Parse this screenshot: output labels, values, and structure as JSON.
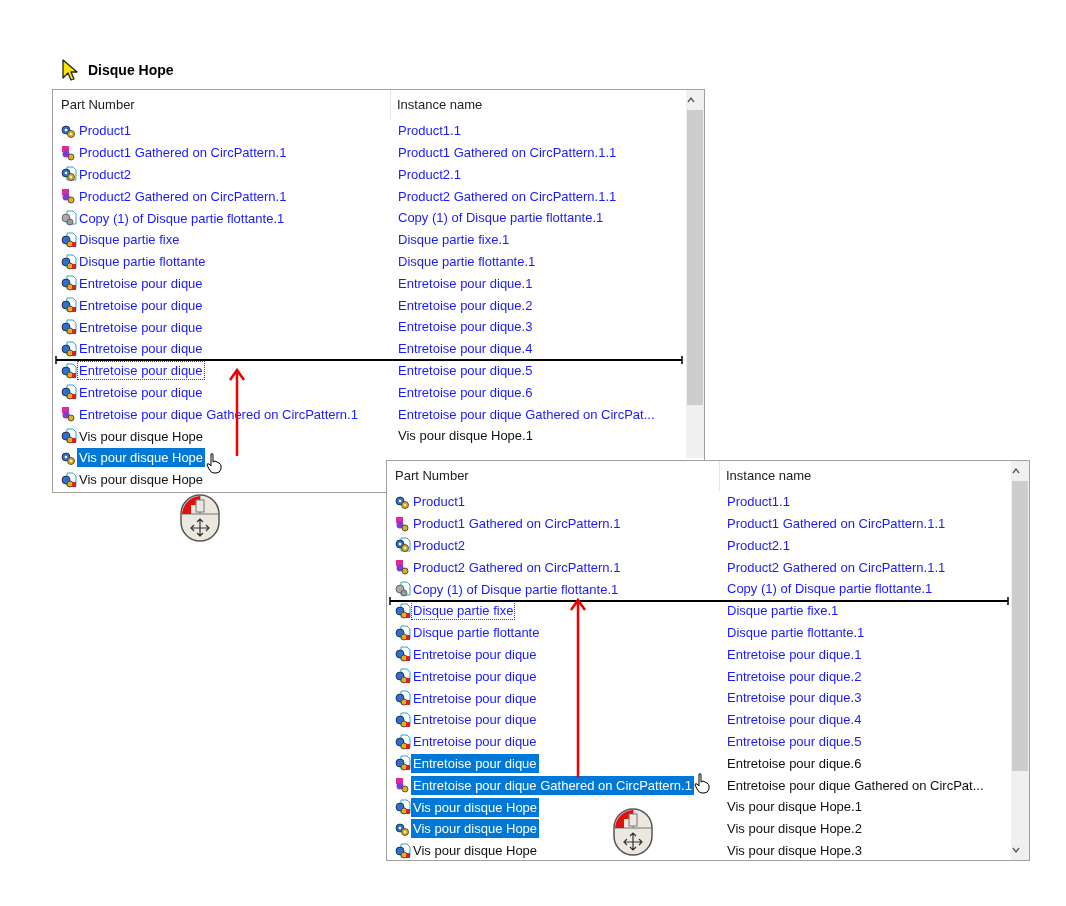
{
  "title": "Disque Hope",
  "panels": [
    {
      "columns": [
        "Part Number",
        "Instance name"
      ],
      "rows": [
        {
          "part": "Product1",
          "instance": "Product1.1",
          "kind": "product",
          "part_blue": true,
          "instance_blue": true,
          "selected": false,
          "focused": false,
          "drop_below": false
        },
        {
          "part": "Product1 Gathered on CircPattern.1",
          "instance": "Product1 Gathered on CircPattern.1.1",
          "kind": "gathered",
          "part_blue": true,
          "instance_blue": true,
          "selected": false,
          "focused": false,
          "drop_below": false
        },
        {
          "part": "Product2",
          "instance": "Product2.1",
          "kind": "product_doc",
          "part_blue": true,
          "instance_blue": true,
          "selected": false,
          "focused": false,
          "drop_below": false
        },
        {
          "part": "Product2 Gathered on CircPattern.1",
          "instance": "Product2 Gathered on CircPattern.1.1",
          "kind": "gathered",
          "part_blue": true,
          "instance_blue": true,
          "selected": false,
          "focused": false,
          "drop_below": false
        },
        {
          "part": "Copy (1) of Disque partie flottante.1",
          "instance": "Copy (1) of Disque partie flottante.1",
          "kind": "copy",
          "part_blue": true,
          "instance_blue": true,
          "selected": false,
          "focused": false,
          "drop_below": false
        },
        {
          "part": "Disque partie fixe",
          "instance": "Disque partie fixe.1",
          "kind": "part",
          "part_blue": true,
          "instance_blue": true,
          "selected": false,
          "focused": false,
          "drop_below": false
        },
        {
          "part": "Disque partie flottante",
          "instance": "Disque partie flottante.1",
          "kind": "part",
          "part_blue": true,
          "instance_blue": true,
          "selected": false,
          "focused": false,
          "drop_below": false
        },
        {
          "part": "Entretoise pour dique",
          "instance": "Entretoise pour dique.1",
          "kind": "part",
          "part_blue": true,
          "instance_blue": true,
          "selected": false,
          "focused": false,
          "drop_below": false
        },
        {
          "part": "Entretoise pour dique",
          "instance": "Entretoise pour dique.2",
          "kind": "part",
          "part_blue": true,
          "instance_blue": true,
          "selected": false,
          "focused": false,
          "drop_below": false
        },
        {
          "part": "Entretoise pour dique",
          "instance": "Entretoise pour dique.3",
          "kind": "part",
          "part_blue": true,
          "instance_blue": true,
          "selected": false,
          "focused": false,
          "drop_below": false
        },
        {
          "part": "Entretoise pour dique",
          "instance": "Entretoise pour dique.4",
          "kind": "part",
          "part_blue": true,
          "instance_blue": true,
          "selected": false,
          "focused": false,
          "drop_below": true
        },
        {
          "part": "Entretoise pour dique",
          "instance": "Entretoise pour dique.5",
          "kind": "part",
          "part_blue": true,
          "instance_blue": true,
          "selected": false,
          "focused": true,
          "drop_below": false
        },
        {
          "part": "Entretoise pour dique",
          "instance": "Entretoise pour dique.6",
          "kind": "part",
          "part_blue": true,
          "instance_blue": true,
          "selected": false,
          "focused": false,
          "drop_below": false
        },
        {
          "part": "Entretoise pour dique Gathered on CircPattern.1",
          "instance": "Entretoise pour dique Gathered on CircPat...",
          "kind": "gathered",
          "part_blue": true,
          "instance_blue": true,
          "selected": false,
          "focused": false,
          "drop_below": false
        },
        {
          "part": "Vis pour disque Hope",
          "instance": "Vis pour disque Hope.1",
          "kind": "part",
          "part_blue": false,
          "instance_blue": false,
          "selected": false,
          "focused": false,
          "drop_below": false
        },
        {
          "part": "Vis pour disque Hope",
          "kind": "product",
          "selected": true,
          "focused": false,
          "drop_below": false
        },
        {
          "part": "Vis pour disque Hope",
          "kind": "part",
          "part_blue": false,
          "selected": false,
          "focused": false,
          "drop_below": false
        }
      ]
    },
    {
      "columns": [
        "Part Number",
        "Instance name"
      ],
      "rows": [
        {
          "part": "Product1",
          "instance": "Product1.1",
          "kind": "product",
          "part_blue": true,
          "instance_blue": true,
          "selected": false,
          "focused": false,
          "drop_below": false
        },
        {
          "part": "Product1 Gathered on CircPattern.1",
          "instance": "Product1 Gathered on CircPattern.1.1",
          "kind": "gathered",
          "part_blue": true,
          "instance_blue": true,
          "selected": false,
          "focused": false,
          "drop_below": false
        },
        {
          "part": "Product2",
          "instance": "Product2.1",
          "kind": "product_doc",
          "part_blue": true,
          "instance_blue": true,
          "selected": false,
          "focused": false,
          "drop_below": false
        },
        {
          "part": "Product2 Gathered on CircPattern.1",
          "instance": "Product2 Gathered on CircPattern.1.1",
          "kind": "gathered",
          "part_blue": true,
          "instance_blue": true,
          "selected": false,
          "focused": false,
          "drop_below": false
        },
        {
          "part": "Copy (1) of Disque partie flottante.1",
          "instance": "Copy (1) of Disque partie flottante.1",
          "kind": "copy",
          "part_blue": true,
          "instance_blue": true,
          "selected": false,
          "focused": false,
          "drop_below": true
        },
        {
          "part": "Disque partie fixe",
          "instance": "Disque partie fixe.1",
          "kind": "part",
          "part_blue": true,
          "instance_blue": true,
          "selected": false,
          "focused": true,
          "drop_below": false
        },
        {
          "part": "Disque partie flottante",
          "instance": "Disque partie flottante.1",
          "kind": "part",
          "part_blue": true,
          "instance_blue": true,
          "selected": false,
          "focused": false,
          "drop_below": false
        },
        {
          "part": "Entretoise pour dique",
          "instance": "Entretoise pour dique.1",
          "kind": "part",
          "part_blue": true,
          "instance_blue": true,
          "selected": false,
          "focused": false,
          "drop_below": false
        },
        {
          "part": "Entretoise pour dique",
          "instance": "Entretoise pour dique.2",
          "kind": "part",
          "part_blue": true,
          "instance_blue": true,
          "selected": false,
          "focused": false,
          "drop_below": false
        },
        {
          "part": "Entretoise pour dique",
          "instance": "Entretoise pour dique.3",
          "kind": "part",
          "part_blue": true,
          "instance_blue": true,
          "selected": false,
          "focused": false,
          "drop_below": false
        },
        {
          "part": "Entretoise pour dique",
          "instance": "Entretoise pour dique.4",
          "kind": "part",
          "part_blue": true,
          "instance_blue": true,
          "selected": false,
          "focused": false,
          "drop_below": false
        },
        {
          "part": "Entretoise pour dique",
          "instance": "Entretoise pour dique.5",
          "kind": "part",
          "part_blue": true,
          "instance_blue": true,
          "selected": false,
          "focused": false,
          "drop_below": false
        },
        {
          "part": "Entretoise pour dique",
          "instance": "Entretoise pour dique.6",
          "kind": "part",
          "instance_blue": false,
          "selected": true,
          "focused": false,
          "drop_below": false
        },
        {
          "part": "Entretoise pour dique Gathered on CircPattern.1",
          "instance": "Entretoise pour dique Gathered on CircPat...",
          "kind": "gathered",
          "instance_blue": false,
          "selected": true,
          "focused": false,
          "drop_below": false
        },
        {
          "part": "Vis pour disque Hope",
          "instance": "Vis pour disque Hope.1",
          "kind": "part",
          "instance_blue": false,
          "selected": true,
          "focused": false,
          "drop_below": false
        },
        {
          "part": "Vis pour disque Hope",
          "instance": "Vis pour disque Hope.2",
          "kind": "product",
          "instance_blue": false,
          "selected": true,
          "focused": false,
          "drop_below": false
        },
        {
          "part": "Vis pour disque Hope",
          "instance": "Vis pour disque Hope.3",
          "kind": "part",
          "part_blue": false,
          "instance_blue": false,
          "selected": false,
          "focused": false,
          "drop_below": false
        }
      ]
    }
  ]
}
